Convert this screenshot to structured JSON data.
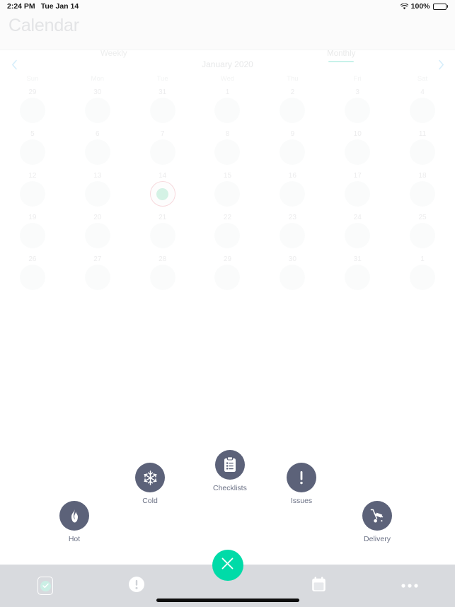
{
  "status_bar": {
    "time": "2:24 PM",
    "date": "Tue Jan 14",
    "wifi_icon": "wifi-icon",
    "battery_percent": "100%",
    "battery_icon": "battery-full-icon"
  },
  "header": {
    "title": "Calendar",
    "tabs": [
      {
        "label": "Weekly",
        "active": false
      },
      {
        "label": "Monthly",
        "active": true
      }
    ],
    "active_tab_underline_color": "#c8f2ea"
  },
  "month_nav": {
    "prev_icon": "chevron-left-icon",
    "next_icon": "chevron-right-icon",
    "month_label": "January 2020",
    "arrow_color": "#d6eefb"
  },
  "calendar": {
    "weekdays": [
      "Sun",
      "Mon",
      "Tue",
      "Wed",
      "Thu",
      "Fri",
      "Sat"
    ],
    "today": 14,
    "today_ring_color": "#f7d9dd",
    "today_dot_color": "#d4f2e5",
    "weeks": [
      [
        {
          "num": "29",
          "today": false
        },
        {
          "num": "30",
          "today": false
        },
        {
          "num": "31",
          "today": false
        },
        {
          "num": "1",
          "today": false
        },
        {
          "num": "2",
          "today": false
        },
        {
          "num": "3",
          "today": false
        },
        {
          "num": "4",
          "today": false
        }
      ],
      [
        {
          "num": "5",
          "today": false
        },
        {
          "num": "6",
          "today": false
        },
        {
          "num": "7",
          "today": false
        },
        {
          "num": "8",
          "today": false
        },
        {
          "num": "9",
          "today": false
        },
        {
          "num": "10",
          "today": false
        },
        {
          "num": "11",
          "today": false
        }
      ],
      [
        {
          "num": "12",
          "today": false
        },
        {
          "num": "13",
          "today": false
        },
        {
          "num": "14",
          "today": true
        },
        {
          "num": "15",
          "today": false
        },
        {
          "num": "16",
          "today": false
        },
        {
          "num": "17",
          "today": false
        },
        {
          "num": "18",
          "today": false
        }
      ],
      [
        {
          "num": "19",
          "today": false
        },
        {
          "num": "20",
          "today": false
        },
        {
          "num": "21",
          "today": false
        },
        {
          "num": "22",
          "today": false
        },
        {
          "num": "23",
          "today": false
        },
        {
          "num": "24",
          "today": false
        },
        {
          "num": "25",
          "today": false
        }
      ],
      [
        {
          "num": "26",
          "today": false
        },
        {
          "num": "27",
          "today": false
        },
        {
          "num": "28",
          "today": false
        },
        {
          "num": "29",
          "today": false
        },
        {
          "num": "30",
          "today": false
        },
        {
          "num": "31",
          "today": false
        },
        {
          "num": "1",
          "today": false
        }
      ]
    ]
  },
  "action_menu": {
    "circle_color": "#5c6279",
    "items": [
      {
        "id": "hot",
        "label": "Hot",
        "icon": "flame-icon"
      },
      {
        "id": "cold",
        "label": "Cold",
        "icon": "snowflake-icon"
      },
      {
        "id": "check",
        "label": "Checklists",
        "icon": "clipboard-icon"
      },
      {
        "id": "issues",
        "label": "Issues",
        "icon": "exclamation-icon"
      },
      {
        "id": "delivery",
        "label": "Delivery",
        "icon": "hand-truck-icon"
      }
    ]
  },
  "tab_bar": {
    "background": "#d8dade",
    "items": [
      {
        "id": "checklists",
        "icon": "checklist-square-icon"
      },
      {
        "id": "issues",
        "icon": "exclamation-circle-icon"
      },
      {
        "id": "calendar",
        "icon": "calendar-icon"
      },
      {
        "id": "more",
        "icon": "ellipsis-icon"
      }
    ],
    "fab": {
      "icon": "close-x-icon",
      "color": "#00dba8"
    }
  }
}
